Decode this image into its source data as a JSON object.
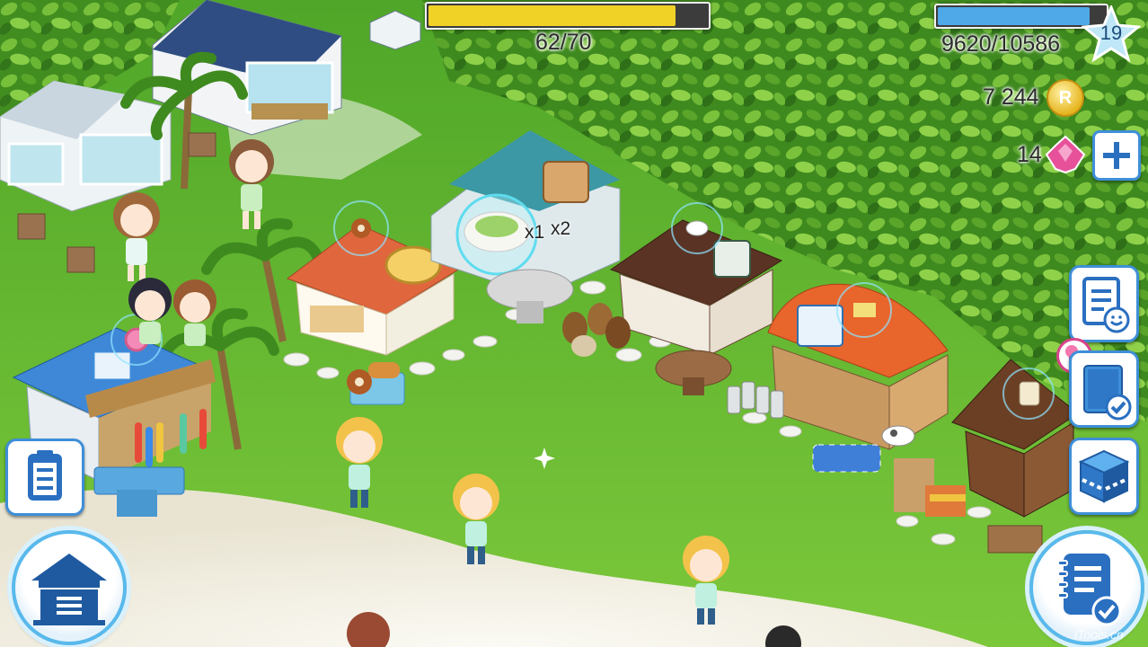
{
  "energy": {
    "text": "62/70",
    "value": 62,
    "max": 70,
    "color": "#f0d227"
  },
  "experience": {
    "text": "9620/10586",
    "value": 9620,
    "max": 10586,
    "color": "#4fa8e8"
  },
  "level": {
    "value": "19"
  },
  "currency": {
    "coins": "7 244",
    "coin_symbol": "R",
    "gems": "14"
  },
  "production": {
    "multiplier_1": "x1",
    "multiplier_2": "x2"
  },
  "buttons": {
    "add_gems": "plus-icon",
    "visitors": "guest-list-icon",
    "tasks": "task-clipboard-icon",
    "storage": "storage-box-icon",
    "orders": "clipboard-icon",
    "home": "home-icon",
    "menu_book": "notebook-icon"
  },
  "watermark": "iTools.cn",
  "colors": {
    "grass": "#5fae2e",
    "sand": "#f2f0e8",
    "ui_blue": "#3e8fd8"
  }
}
